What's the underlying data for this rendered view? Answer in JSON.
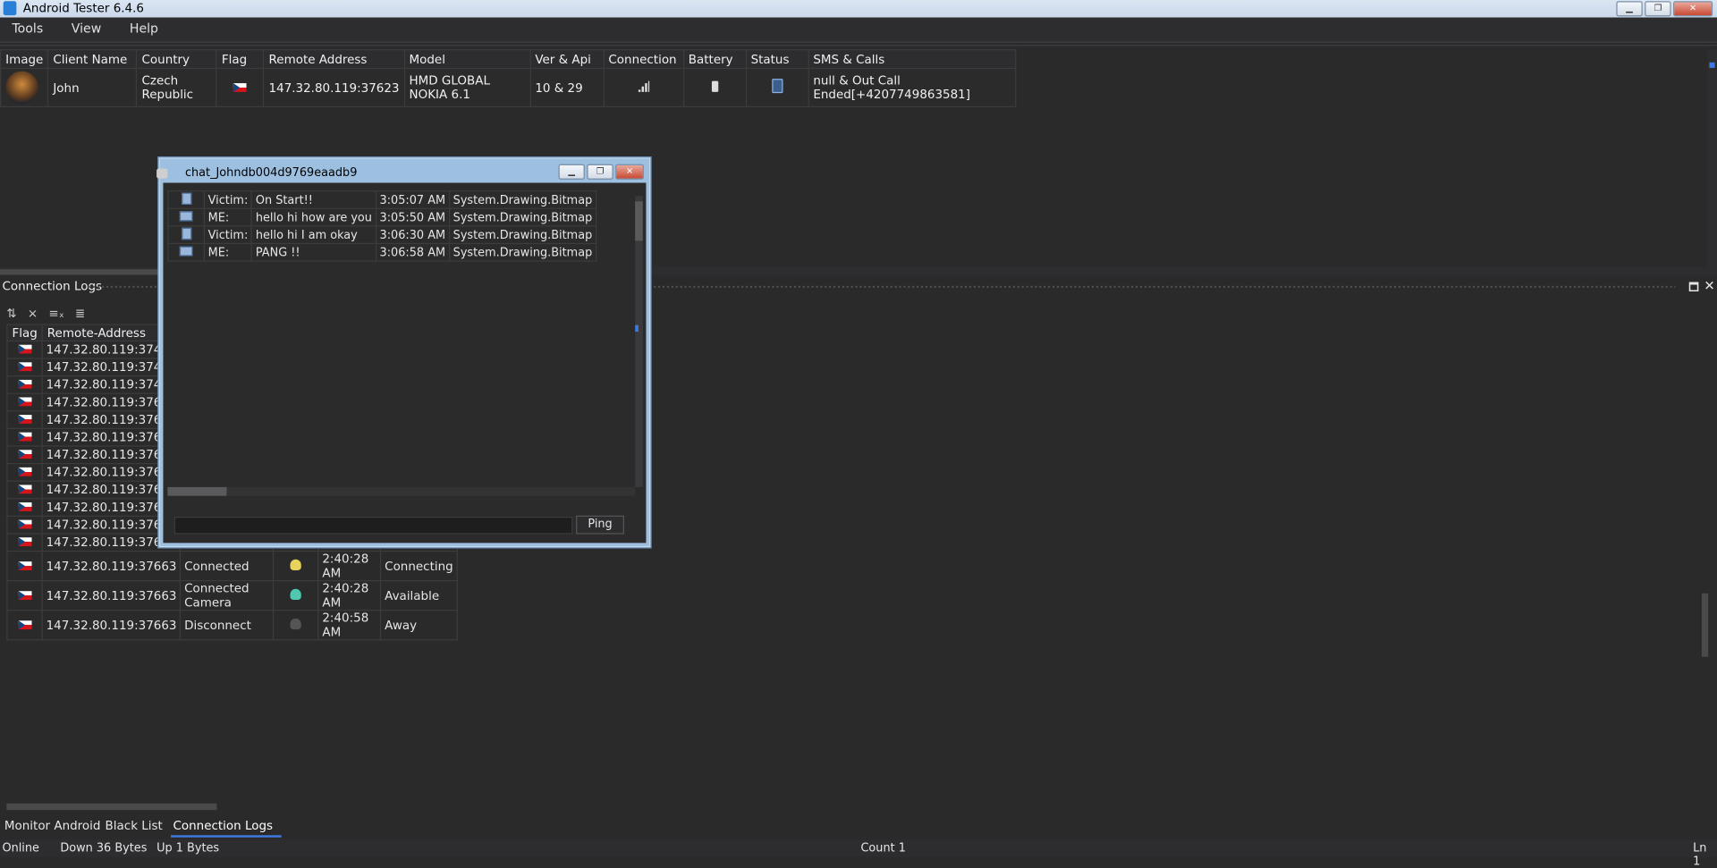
{
  "window": {
    "title": "Android Tester 6.4.6"
  },
  "menu": [
    "Tools",
    "View",
    "Help"
  ],
  "clients": {
    "headers": [
      "Image",
      "Client Name",
      "Country",
      "Flag",
      "Remote Address",
      "Model",
      "Ver & Api",
      "Connection",
      "Battery",
      "Status",
      "SMS & Calls"
    ],
    "rows": [
      {
        "name": "John",
        "country": "Czech Republic",
        "remote": "147.32.80.119:37623",
        "model": "HMD GLOBAL NOKIA 6.1",
        "ver": "10 & 29",
        "sms": "null & Out Call Ended[+4207749863581]"
      }
    ]
  },
  "logs_panel": {
    "title": "Connection Logs",
    "headers": [
      "Flag",
      "Remote-Address"
    ],
    "rows": [
      {
        "addr": "147.32.80.119:37451",
        "status": "",
        "time": "",
        "state": ""
      },
      {
        "addr": "147.32.80.119:37451",
        "status": "",
        "time": "",
        "state": ""
      },
      {
        "addr": "147.32.80.119:37451",
        "status": "",
        "time": "",
        "state": ""
      },
      {
        "addr": "147.32.80.119:37623",
        "status": "",
        "time": "",
        "state": ""
      },
      {
        "addr": "147.32.80.119:37623",
        "status": "",
        "time": "",
        "state": ""
      },
      {
        "addr": "147.32.80.119:37649",
        "status": "",
        "time": "",
        "state": ""
      },
      {
        "addr": "147.32.80.119:37649",
        "status": "",
        "time": "",
        "state": ""
      },
      {
        "addr": "147.32.80.119:37649",
        "status": "",
        "time": "",
        "state": ""
      },
      {
        "addr": "147.32.80.119:37649",
        "status": "",
        "time": "",
        "state": ""
      },
      {
        "addr": "147.32.80.119:37661",
        "status": "",
        "time": "",
        "state": ""
      },
      {
        "addr": "147.32.80.119:37661",
        "status": "",
        "time": "",
        "state": ""
      },
      {
        "addr": "147.32.80.119:37661",
        "status": "",
        "time": "",
        "state": ""
      },
      {
        "addr": "147.32.80.119:37663",
        "status": "Connected",
        "time": "2:40:28 AM",
        "state": "Connecting"
      },
      {
        "addr": "147.32.80.119:37663",
        "status": "Connected Camera",
        "time": "2:40:28 AM",
        "state": "Available"
      },
      {
        "addr": "147.32.80.119:37663",
        "status": "Disconnect",
        "time": "2:40:58 AM",
        "state": "Away"
      }
    ]
  },
  "chat": {
    "title": "chat_Johndb004d9769eaadb9",
    "messages": [
      {
        "who": "Victim:",
        "text": "On Start!!",
        "time": "3:05:07 AM",
        "extra": "System.Drawing.Bitmap"
      },
      {
        "who": "ME:",
        "text": "hello hi how are you",
        "time": "3:05:50 AM",
        "extra": "System.Drawing.Bitmap"
      },
      {
        "who": "Victim:",
        "text": "hello hi I am okay",
        "time": "3:06:30 AM",
        "extra": "System.Drawing.Bitmap"
      },
      {
        "who": "ME:",
        "text": "PANG !!",
        "time": "3:06:58 AM",
        "extra": "System.Drawing.Bitmap"
      }
    ],
    "ping_label": "Ping",
    "input_value": ""
  },
  "tabs": [
    "Monitor Android",
    "Black List",
    "Connection Logs"
  ],
  "status": {
    "online": "Online",
    "down": "Down 36 Bytes",
    "up": "Up 1 Bytes",
    "count": "Count 1",
    "ln": "Ln 1"
  }
}
